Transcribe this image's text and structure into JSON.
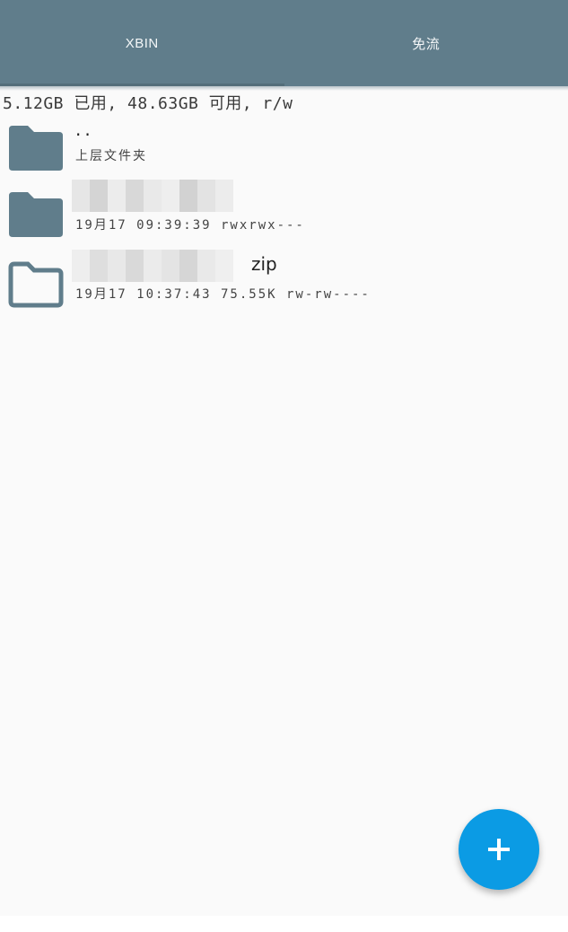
{
  "tabs": [
    {
      "label": "XBIN",
      "active": true
    },
    {
      "label": "免流",
      "active": false
    }
  ],
  "storage_text": "5.12GB 已用, 48.63GB 可用, r/w",
  "files": [
    {
      "name": "..",
      "meta": "上层文件夹",
      "icon": "folder-filled-icon"
    },
    {
      "name": "",
      "meta": "19月17 09:39:39  rwxrwx---",
      "icon": "folder-filled-icon"
    },
    {
      "name": "zip",
      "meta": "19月17 10:37:43 75.55K rw-rw----",
      "icon": "folder-outline-icon"
    }
  ],
  "fab": {
    "icon": "plus-icon"
  },
  "colors": {
    "appbar": "#607d8b",
    "icon": "#607d8b",
    "fab": "#0b9be4",
    "background": "#fafafa"
  }
}
